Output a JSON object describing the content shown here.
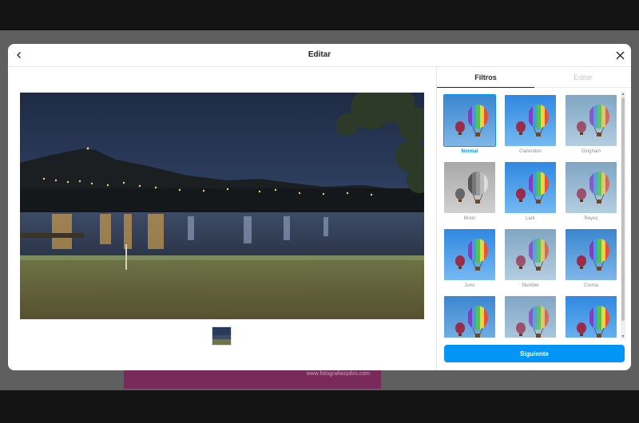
{
  "modal": {
    "title": "Editar",
    "back_icon": "chevron-left-icon",
    "close_icon": "close-icon"
  },
  "tabs": [
    {
      "label": "Filtros",
      "active": true
    },
    {
      "label": "Editar",
      "active": false
    }
  ],
  "filters": [
    {
      "label": "Normal",
      "selected": true,
      "style": "normal"
    },
    {
      "label": "Clarendon",
      "selected": false,
      "style": "bright"
    },
    {
      "label": "Gingham",
      "selected": false,
      "style": "faded"
    },
    {
      "label": "Moon",
      "selected": false,
      "style": "mono"
    },
    {
      "label": "Lark",
      "selected": false,
      "style": "bright"
    },
    {
      "label": "Reyes",
      "selected": false,
      "style": "faded"
    },
    {
      "label": "Juno",
      "selected": false,
      "style": "bright"
    },
    {
      "label": "Slumber",
      "selected": false,
      "style": "faded"
    },
    {
      "label": "Crema",
      "selected": false,
      "style": "normal"
    },
    {
      "label": "",
      "selected": false,
      "style": "normal"
    },
    {
      "label": "",
      "selected": false,
      "style": "faded"
    },
    {
      "label": "",
      "selected": false,
      "style": "bright"
    }
  ],
  "next_button": {
    "label": "Siguiente"
  },
  "background_card": {
    "text": "www.fotografiasydos.com"
  },
  "colors": {
    "accent": "#0095f6",
    "backdrop": "#5f5f5f",
    "background_card": "#7a2a5a"
  }
}
